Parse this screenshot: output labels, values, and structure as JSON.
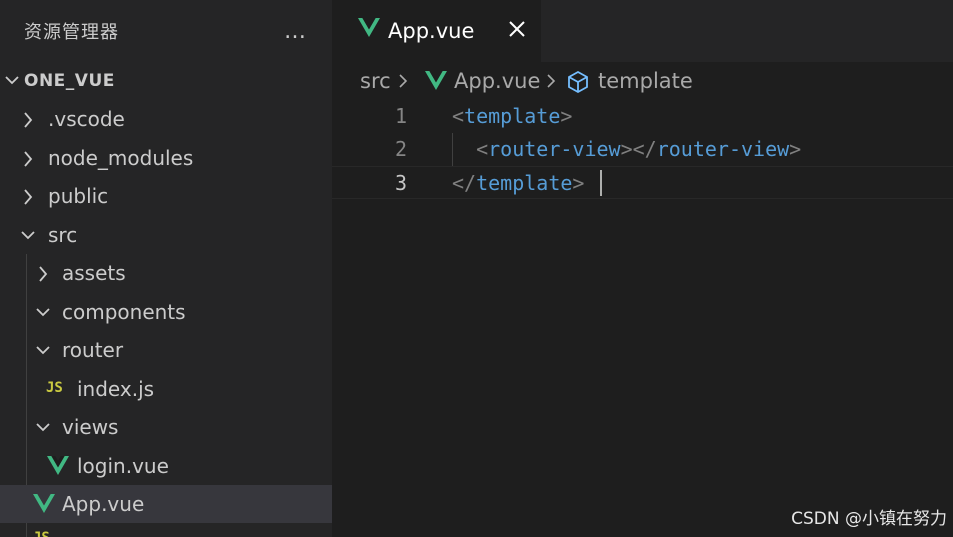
{
  "sidebar": {
    "title": "资源管理器",
    "more_icon": "…",
    "root": "ONE_VUE",
    "items": [
      {
        "label": ".vscode",
        "type": "folder",
        "expanded": false
      },
      {
        "label": "node_modules",
        "type": "folder",
        "expanded": false
      },
      {
        "label": "public",
        "type": "folder",
        "expanded": false
      },
      {
        "label": "src",
        "type": "folder",
        "expanded": true
      },
      {
        "label": "assets",
        "type": "folder",
        "expanded": false
      },
      {
        "label": "components",
        "type": "folder",
        "expanded": true
      },
      {
        "label": "router",
        "type": "folder",
        "expanded": true
      },
      {
        "label": "index.js",
        "type": "js-file",
        "badge": "JS"
      },
      {
        "label": "views",
        "type": "folder",
        "expanded": true
      },
      {
        "label": "login.vue",
        "type": "vue-file"
      },
      {
        "label": "App.vue",
        "type": "vue-file",
        "selected": true
      }
    ]
  },
  "editor": {
    "tab": {
      "label": "App.vue",
      "close_icon": "close-icon"
    },
    "breadcrumb": [
      "src",
      "App.vue",
      "template"
    ],
    "lines": [
      {
        "number": "1",
        "open": "<",
        "tag": "template",
        "close": ">"
      },
      {
        "number": "2",
        "indent": "  ",
        "open": "<",
        "tag": "router-view",
        "mid": "></",
        "tag2": "router-view",
        "close": ">"
      },
      {
        "number": "3",
        "open": "</",
        "tag": "template",
        "close": ">"
      }
    ]
  },
  "watermark": "CSDN @小镇在努力",
  "colors": {
    "sidebar_bg": "#252526",
    "editor_bg": "#1e1e1e",
    "selected_row": "#37373d",
    "vue_green": "#41b883",
    "js_yellow": "#cbcb41",
    "tag_blue": "#569cd6"
  }
}
